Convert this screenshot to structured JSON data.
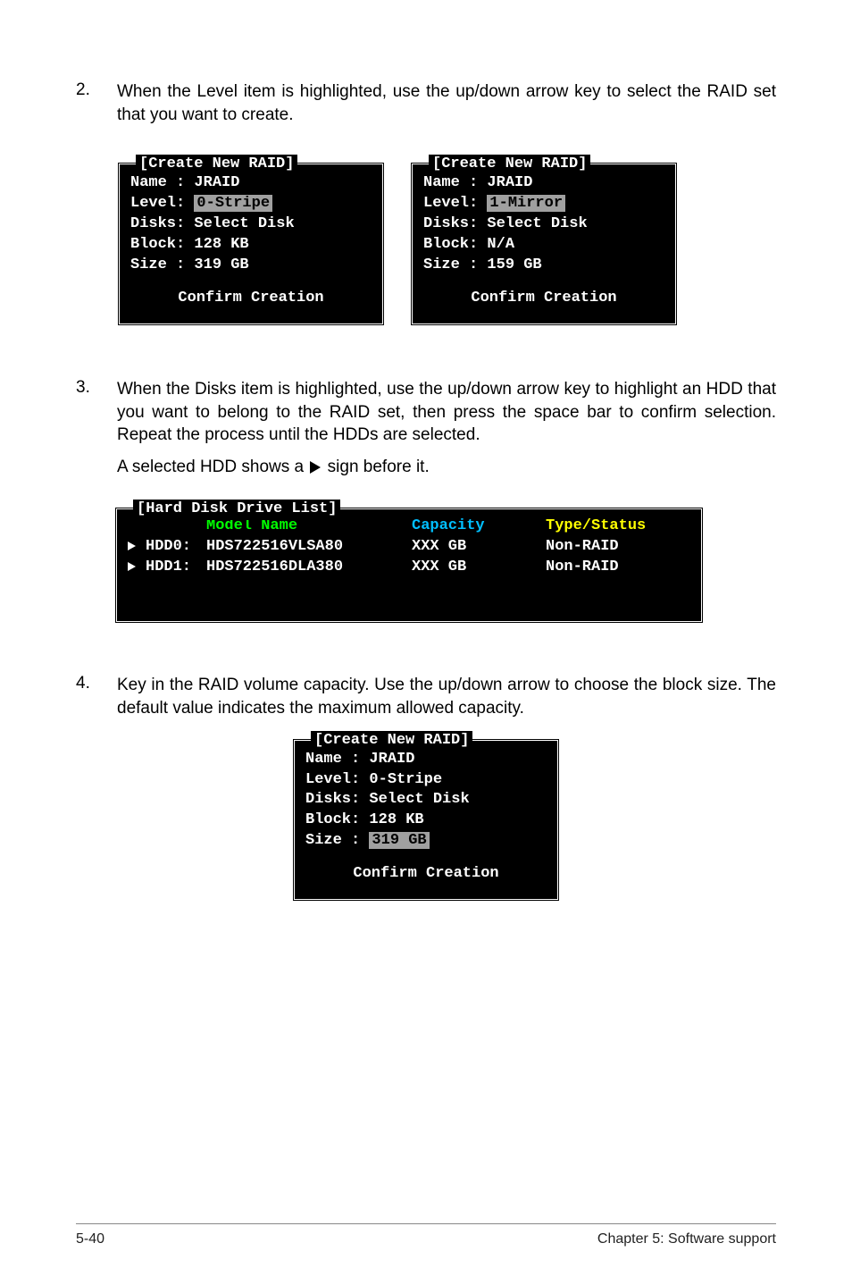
{
  "steps": {
    "s2": {
      "num": "2.",
      "text": "When the Level item is highlighted, use the up/down arrow key to select the RAID set that you want to create."
    },
    "s3": {
      "num": "3.",
      "text": "When the Disks item is highlighted, use the up/down arrow key to highlight an HDD that you want to belong to the RAID set, then press the space bar to confirm selection. Repeat the process until the HDDs are selected.",
      "note_before": "A selected HDD shows a ",
      "note_after": " sign before it."
    },
    "s4": {
      "num": "4.",
      "text": "Key in the RAID volume capacity. Use the up/down arrow to choose the block size. The default value indicates the maximum allowed capacity."
    }
  },
  "create_stripe": {
    "title": "[Create New RAID]",
    "name_label": "Name :",
    "name_val": "JRAID",
    "level_label": "Level:",
    "level_val": "0-Stripe",
    "disks_label": "Disks:",
    "disks_val": "Select Disk",
    "block_label": "Block:",
    "block_val": "128 KB",
    "size_label": "Size :",
    "size_val": "319 GB",
    "confirm": "Confirm Creation"
  },
  "create_mirror": {
    "title": "[Create New RAID]",
    "name_label": "Name :",
    "name_val": "JRAID",
    "level_label": "Level:",
    "level_val": "1-Mirror",
    "disks_label": "Disks:",
    "disks_val": "Select Disk",
    "block_label": "Block:",
    "block_val": "N/A",
    "size_label": "Size :",
    "size_val": "159 GB",
    "confirm": "Confirm Creation"
  },
  "drive_list": {
    "title": "[Hard Disk Drive List]",
    "hdr_model": "Model Name",
    "hdr_cap": "Capacity",
    "hdr_type": "Type/Status",
    "rows": [
      {
        "slot": "HDD0:",
        "model": "HDS722516VLSA80",
        "cap": "XXX GB",
        "type": "Non-RAID"
      },
      {
        "slot": "HDD1:",
        "model": "HDS722516DLA380",
        "cap": "XXX GB",
        "type": "Non-RAID"
      }
    ]
  },
  "create_size": {
    "title": "[Create New RAID]",
    "name_label": "Name :",
    "name_val": "JRAID",
    "level_label": "Level:",
    "level_val": "0-Stripe",
    "disks_label": "Disks:",
    "disks_val": "Select Disk",
    "block_label": "Block:",
    "block_val": "128 KB",
    "size_label": "Size :",
    "size_val": "319 GB",
    "confirm": "Confirm Creation"
  },
  "footer": {
    "left": "5-40",
    "right": "Chapter 5: Software support"
  }
}
